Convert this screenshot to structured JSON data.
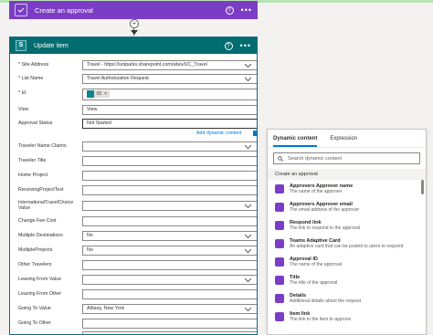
{
  "approval": {
    "title": "Create an approval",
    "help": "?",
    "more": "•••"
  },
  "connector": {
    "plus": "+"
  },
  "update_item": {
    "title": "Update item",
    "help": "?",
    "more": "•••",
    "fields": [
      {
        "label": "* Site Address",
        "value": "Travel - https://uniparks.sharepoint.com/sites/UC_Travel",
        "dropdown": true
      },
      {
        "label": "* List Name",
        "value": "Travel Authorization Request",
        "dropdown": true
      },
      {
        "label": "* Id",
        "token": "ID",
        "token_close": "×"
      },
      {
        "label": "View",
        "value": "View"
      },
      {
        "label": "Approval Status",
        "value": "Not Started"
      },
      {
        "label": "Traveler Name Claims",
        "value": "",
        "dropdown": true
      },
      {
        "label": "Traveler Title",
        "value": ""
      },
      {
        "label": "Home Project",
        "value": ""
      },
      {
        "label": "ReceivingProjectText",
        "value": ""
      },
      {
        "label": "InternationalTravelChoice Value",
        "value": "",
        "dropdown": true
      },
      {
        "label": "Change Fee Cost",
        "value": ""
      },
      {
        "label": "Multiple Destinations",
        "value": "No",
        "dropdown": true
      },
      {
        "label": "MultipleProjects",
        "value": "No",
        "dropdown": true
      },
      {
        "label": "Other Travelers",
        "value": ""
      },
      {
        "label": "Leaving From Value",
        "value": "",
        "dropdown": true
      },
      {
        "label": "Leaving From Other",
        "value": ""
      },
      {
        "label": "Going To Value",
        "value": "Albany, New York",
        "dropdown": true
      },
      {
        "label": "Going To Other",
        "value": ""
      },
      {
        "label": "",
        "value": "",
        "dropdown": true
      }
    ],
    "add_dynamic_content": "Add dynamic content"
  },
  "dynamic_panel": {
    "tabs": [
      "Dynamic content",
      "Expression"
    ],
    "search_placeholder": "Search dynamic content",
    "section": "Create an approval",
    "items": [
      {
        "name": "Approvers Approver name",
        "desc": "The name of the approver"
      },
      {
        "name": "Approvers Approver email",
        "desc": "The email address of the approver"
      },
      {
        "name": "Respond link",
        "desc": "The link to respond to the approval"
      },
      {
        "name": "Teams Adaptive Card",
        "desc": "An adaptive card that can be posted to users to respond"
      },
      {
        "name": "Approval ID",
        "desc": "The name of the approval"
      },
      {
        "name": "Title",
        "desc": "The title of the approval"
      },
      {
        "name": "Details",
        "desc": "Additional details about the request"
      },
      {
        "name": "Item link",
        "desc": "The link to the item to approve"
      }
    ]
  },
  "colors": {
    "approval": "#7c3dc6",
    "sharepoint": "#036c70",
    "link": "#0078d4"
  }
}
